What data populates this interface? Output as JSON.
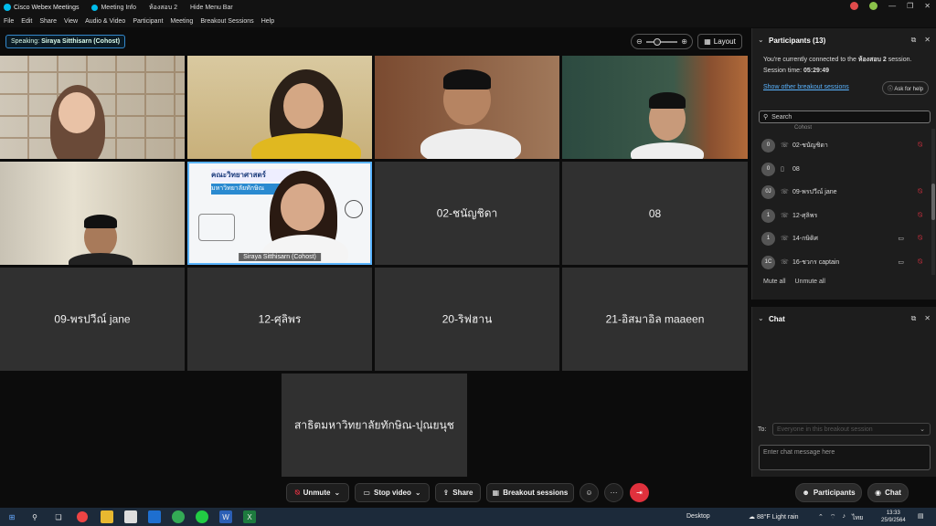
{
  "titlebar": {
    "app_name": "Cisco Webex Meetings",
    "meeting_info": "Meeting Info",
    "room": "ห้องสอบ 2",
    "hide_menu": "Hide Menu Bar"
  },
  "menu": [
    "File",
    "Edit",
    "Share",
    "View",
    "Audio & Video",
    "Participant",
    "Meeting",
    "Breakout Sessions",
    "Help"
  ],
  "speaking": {
    "prefix": "Speaking:",
    "name": "Siraya Sitthisarn (Cohost)"
  },
  "layout_label": "Layout",
  "tiles": {
    "video_name": "Siraya Sitthisarn  (Cohost)",
    "t7": "02-ชนัญชิดา",
    "t8": "08",
    "t9": "09-พรปวีณ์ jane",
    "t10": "12-ศุลิพร",
    "t11": "20-ริฟฮาน",
    "t12": "21-อิสมาอิล maaeen",
    "t13": "สาธิตมหาวิทยาลัยทักษิณ-ปุณยนุช"
  },
  "participants": {
    "title": "Participants (13)",
    "connected_prefix": "You're currently connected to the",
    "connected_room": "ห้องสอบ 2",
    "connected_suffix": "session.",
    "session_time_label": "Session time:",
    "session_time": "05:29:49",
    "show_other": "Show other breakout sessions",
    "ask_help": "Ask for help",
    "search_placeholder": "Search",
    "partial_row": "Cohost",
    "rows": [
      {
        "avatar": "0",
        "name": "02-ชนัญชิดา"
      },
      {
        "avatar": "0",
        "name": "08"
      },
      {
        "avatar": "0J",
        "name": "09-พรปวีณ์ jane"
      },
      {
        "avatar": "1",
        "name": "12-ศุลิพร"
      },
      {
        "avatar": "1",
        "name": "14-กษิดิศ"
      },
      {
        "avatar": "1C",
        "name": "16-ชวกร captain"
      }
    ],
    "mute_all": "Mute all",
    "unmute_all": "Unmute all"
  },
  "chat": {
    "title": "Chat",
    "to_label": "To:",
    "to_placeholder": "Everyone in this breakout session",
    "input_placeholder": "Enter chat message here"
  },
  "controls": {
    "unmute": "Unmute",
    "stop_video": "Stop video",
    "share": "Share",
    "breakout": "Breakout sessions",
    "more": "···",
    "participants": "Participants",
    "chat": "Chat"
  },
  "taskbar": {
    "desktop": "Desktop",
    "weather": "88°F  Light rain",
    "lang": "ไทย",
    "time": "13:33",
    "date": "25/9/2564"
  },
  "colors": {
    "accent": "#00bceb",
    "end": "#e0313d",
    "link": "#5ab4ff",
    "mute": "#e34444"
  }
}
